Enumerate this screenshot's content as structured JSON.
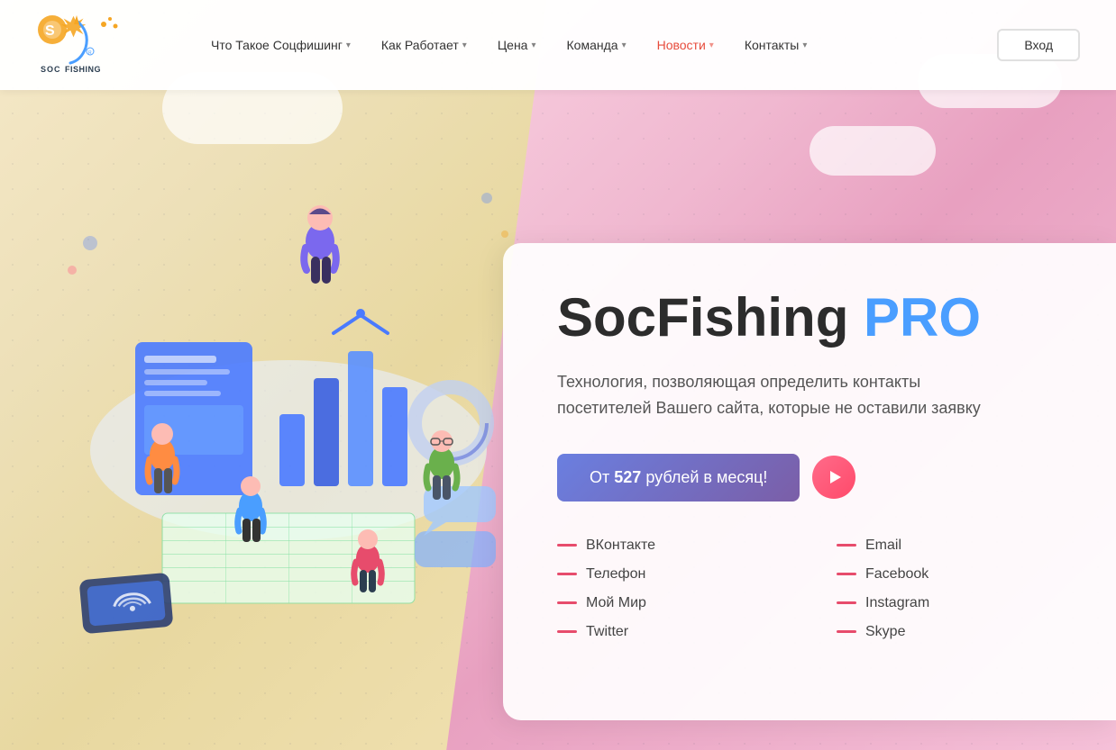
{
  "navbar": {
    "logo_text": "SOC FISHING",
    "nav_items": [
      {
        "id": "what",
        "label": "Что Такое Соцфишинг",
        "has_caret": true,
        "active": false
      },
      {
        "id": "how",
        "label": "Как Работает",
        "has_caret": true,
        "active": false
      },
      {
        "id": "price",
        "label": "Цена",
        "has_caret": true,
        "active": false
      },
      {
        "id": "team",
        "label": "Команда",
        "has_caret": true,
        "active": false
      },
      {
        "id": "news",
        "label": "Новости",
        "has_caret": true,
        "active": true
      },
      {
        "id": "contacts",
        "label": "Контакты",
        "has_caret": true,
        "active": false
      }
    ],
    "login_label": "Вход"
  },
  "hero": {
    "title_main": "SocFishing",
    "title_pro": "PRO",
    "subtitle": "Технология, позволяющая определить контакты посетителей Вашего сайта, которые не оставили заявку",
    "cta_prefix": "От",
    "cta_price": "527",
    "cta_suffix": "рублей в месяц!",
    "features_left": [
      {
        "id": "vk",
        "label": "ВКонтакте"
      },
      {
        "id": "phone",
        "label": "Телефон"
      },
      {
        "id": "myworld",
        "label": "Мой Мир"
      },
      {
        "id": "twitter",
        "label": "Twitter"
      }
    ],
    "features_right": [
      {
        "id": "email",
        "label": "Email"
      },
      {
        "id": "facebook",
        "label": "Facebook"
      },
      {
        "id": "instagram",
        "label": "Instagram"
      },
      {
        "id": "skype",
        "label": "Skype"
      }
    ]
  },
  "colors": {
    "accent_blue": "#4a9eff",
    "accent_red": "#e74c6c",
    "nav_active": "#e74c3c",
    "cta_gradient_start": "#6a7fe0",
    "cta_gradient_end": "#7b5ea7",
    "arrow_gradient_start": "#ff6b8a",
    "arrow_gradient_end": "#ff4a6a"
  }
}
